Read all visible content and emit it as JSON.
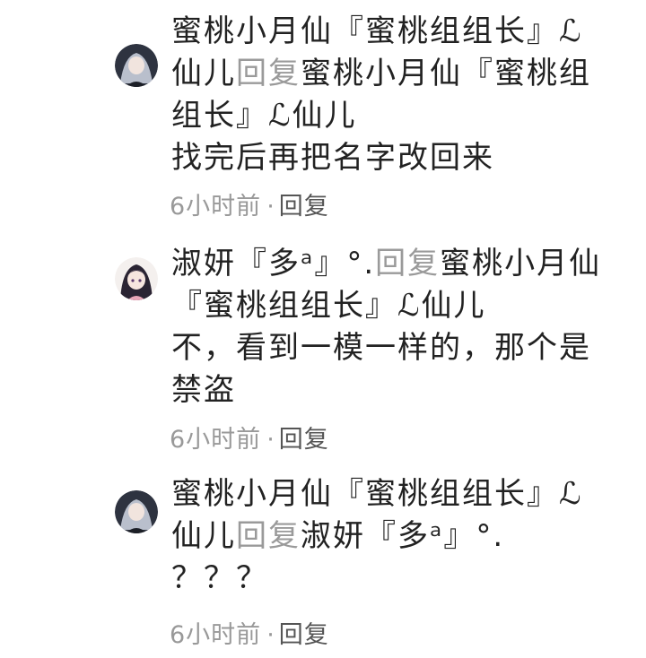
{
  "comments": [
    {
      "author": "蜜桃小月仙『蜜桃组组长』ℒ仙儿",
      "reply_word": "回复",
      "reply_to": "蜜桃小月仙『蜜桃组组长』ℒ仙儿",
      "text": "找完后再把名字改回来",
      "time": "6小时前",
      "dot": "·",
      "reply_action": "回复",
      "avatar_icon": "avatar-anime-silver-hair"
    },
    {
      "author": "淑妍『多ᵃ』°.",
      "reply_word": "回复",
      "reply_to": "蜜桃小月仙『蜜桃组组长』ℒ仙儿",
      "text": "不，看到一模一样的，那个是禁盗",
      "time": "6小时前",
      "dot": "·",
      "reply_action": "回复",
      "avatar_icon": "avatar-anime-dark-hair-girl"
    },
    {
      "author": "蜜桃小月仙『蜜桃组组长』ℒ仙儿",
      "reply_word": "回复",
      "reply_to": "淑妍『多ᵃ』°.",
      "text": "？？？",
      "time": "6小时前",
      "dot": "·",
      "reply_action": "回复",
      "avatar_icon": "avatar-anime-silver-hair"
    }
  ]
}
